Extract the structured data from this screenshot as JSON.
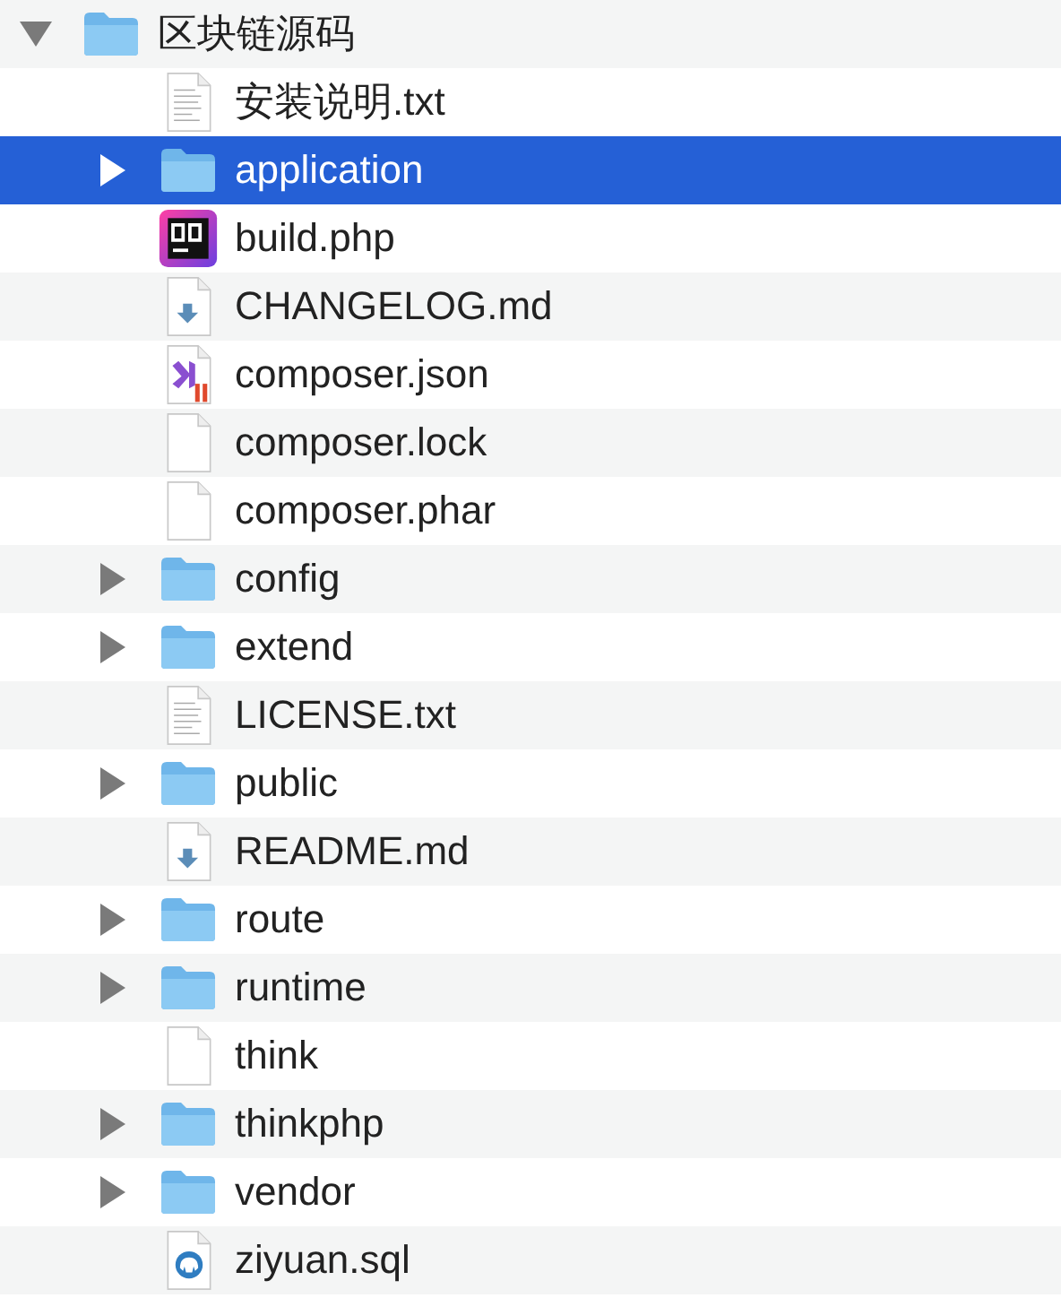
{
  "tree": {
    "name": "区块链源码",
    "kind": "folder",
    "expanded": true,
    "selected": false,
    "children": [
      {
        "name": "安装说明.txt",
        "kind": "text",
        "selected": false
      },
      {
        "name": "application",
        "kind": "folder",
        "expanded": false,
        "selected": true
      },
      {
        "name": "build.php",
        "kind": "php",
        "selected": false
      },
      {
        "name": "CHANGELOG.md",
        "kind": "markdown",
        "selected": false
      },
      {
        "name": "composer.json",
        "kind": "json",
        "selected": false
      },
      {
        "name": "composer.lock",
        "kind": "blank",
        "selected": false
      },
      {
        "name": "composer.phar",
        "kind": "blank",
        "selected": false
      },
      {
        "name": "config",
        "kind": "folder",
        "expanded": false,
        "selected": false
      },
      {
        "name": "extend",
        "kind": "folder",
        "expanded": false,
        "selected": false
      },
      {
        "name": "LICENSE.txt",
        "kind": "text",
        "selected": false
      },
      {
        "name": "public",
        "kind": "folder",
        "expanded": false,
        "selected": false
      },
      {
        "name": "README.md",
        "kind": "markdown",
        "selected": false
      },
      {
        "name": "route",
        "kind": "folder",
        "expanded": false,
        "selected": false
      },
      {
        "name": "runtime",
        "kind": "folder",
        "expanded": false,
        "selected": false
      },
      {
        "name": "think",
        "kind": "blank",
        "selected": false
      },
      {
        "name": "thinkphp",
        "kind": "folder",
        "expanded": false,
        "selected": false
      },
      {
        "name": "vendor",
        "kind": "folder",
        "expanded": false,
        "selected": false
      },
      {
        "name": "ziyuan.sql",
        "kind": "sql",
        "selected": false
      }
    ]
  }
}
